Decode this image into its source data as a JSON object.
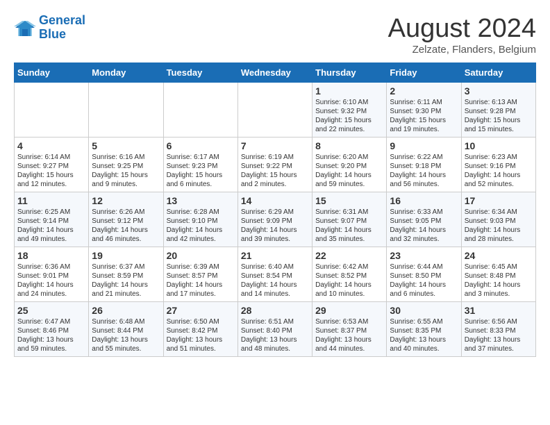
{
  "header": {
    "logo_line1": "General",
    "logo_line2": "Blue",
    "month_year": "August 2024",
    "location": "Zelzate, Flanders, Belgium"
  },
  "weekdays": [
    "Sunday",
    "Monday",
    "Tuesday",
    "Wednesday",
    "Thursday",
    "Friday",
    "Saturday"
  ],
  "weeks": [
    [
      {
        "day": "",
        "info": ""
      },
      {
        "day": "",
        "info": ""
      },
      {
        "day": "",
        "info": ""
      },
      {
        "day": "",
        "info": ""
      },
      {
        "day": "1",
        "info": "Sunrise: 6:10 AM\nSunset: 9:32 PM\nDaylight: 15 hours and 22 minutes."
      },
      {
        "day": "2",
        "info": "Sunrise: 6:11 AM\nSunset: 9:30 PM\nDaylight: 15 hours and 19 minutes."
      },
      {
        "day": "3",
        "info": "Sunrise: 6:13 AM\nSunset: 9:28 PM\nDaylight: 15 hours and 15 minutes."
      }
    ],
    [
      {
        "day": "4",
        "info": "Sunrise: 6:14 AM\nSunset: 9:27 PM\nDaylight: 15 hours and 12 minutes."
      },
      {
        "day": "5",
        "info": "Sunrise: 6:16 AM\nSunset: 9:25 PM\nDaylight: 15 hours and 9 minutes."
      },
      {
        "day": "6",
        "info": "Sunrise: 6:17 AM\nSunset: 9:23 PM\nDaylight: 15 hours and 6 minutes."
      },
      {
        "day": "7",
        "info": "Sunrise: 6:19 AM\nSunset: 9:22 PM\nDaylight: 15 hours and 2 minutes."
      },
      {
        "day": "8",
        "info": "Sunrise: 6:20 AM\nSunset: 9:20 PM\nDaylight: 14 hours and 59 minutes."
      },
      {
        "day": "9",
        "info": "Sunrise: 6:22 AM\nSunset: 9:18 PM\nDaylight: 14 hours and 56 minutes."
      },
      {
        "day": "10",
        "info": "Sunrise: 6:23 AM\nSunset: 9:16 PM\nDaylight: 14 hours and 52 minutes."
      }
    ],
    [
      {
        "day": "11",
        "info": "Sunrise: 6:25 AM\nSunset: 9:14 PM\nDaylight: 14 hours and 49 minutes."
      },
      {
        "day": "12",
        "info": "Sunrise: 6:26 AM\nSunset: 9:12 PM\nDaylight: 14 hours and 46 minutes."
      },
      {
        "day": "13",
        "info": "Sunrise: 6:28 AM\nSunset: 9:10 PM\nDaylight: 14 hours and 42 minutes."
      },
      {
        "day": "14",
        "info": "Sunrise: 6:29 AM\nSunset: 9:09 PM\nDaylight: 14 hours and 39 minutes."
      },
      {
        "day": "15",
        "info": "Sunrise: 6:31 AM\nSunset: 9:07 PM\nDaylight: 14 hours and 35 minutes."
      },
      {
        "day": "16",
        "info": "Sunrise: 6:33 AM\nSunset: 9:05 PM\nDaylight: 14 hours and 32 minutes."
      },
      {
        "day": "17",
        "info": "Sunrise: 6:34 AM\nSunset: 9:03 PM\nDaylight: 14 hours and 28 minutes."
      }
    ],
    [
      {
        "day": "18",
        "info": "Sunrise: 6:36 AM\nSunset: 9:01 PM\nDaylight: 14 hours and 24 minutes."
      },
      {
        "day": "19",
        "info": "Sunrise: 6:37 AM\nSunset: 8:59 PM\nDaylight: 14 hours and 21 minutes."
      },
      {
        "day": "20",
        "info": "Sunrise: 6:39 AM\nSunset: 8:57 PM\nDaylight: 14 hours and 17 minutes."
      },
      {
        "day": "21",
        "info": "Sunrise: 6:40 AM\nSunset: 8:54 PM\nDaylight: 14 hours and 14 minutes."
      },
      {
        "day": "22",
        "info": "Sunrise: 6:42 AM\nSunset: 8:52 PM\nDaylight: 14 hours and 10 minutes."
      },
      {
        "day": "23",
        "info": "Sunrise: 6:44 AM\nSunset: 8:50 PM\nDaylight: 14 hours and 6 minutes."
      },
      {
        "day": "24",
        "info": "Sunrise: 6:45 AM\nSunset: 8:48 PM\nDaylight: 14 hours and 3 minutes."
      }
    ],
    [
      {
        "day": "25",
        "info": "Sunrise: 6:47 AM\nSunset: 8:46 PM\nDaylight: 13 hours and 59 minutes."
      },
      {
        "day": "26",
        "info": "Sunrise: 6:48 AM\nSunset: 8:44 PM\nDaylight: 13 hours and 55 minutes."
      },
      {
        "day": "27",
        "info": "Sunrise: 6:50 AM\nSunset: 8:42 PM\nDaylight: 13 hours and 51 minutes."
      },
      {
        "day": "28",
        "info": "Sunrise: 6:51 AM\nSunset: 8:40 PM\nDaylight: 13 hours and 48 minutes."
      },
      {
        "day": "29",
        "info": "Sunrise: 6:53 AM\nSunset: 8:37 PM\nDaylight: 13 hours and 44 minutes."
      },
      {
        "day": "30",
        "info": "Sunrise: 6:55 AM\nSunset: 8:35 PM\nDaylight: 13 hours and 40 minutes."
      },
      {
        "day": "31",
        "info": "Sunrise: 6:56 AM\nSunset: 8:33 PM\nDaylight: 13 hours and 37 minutes."
      }
    ]
  ]
}
